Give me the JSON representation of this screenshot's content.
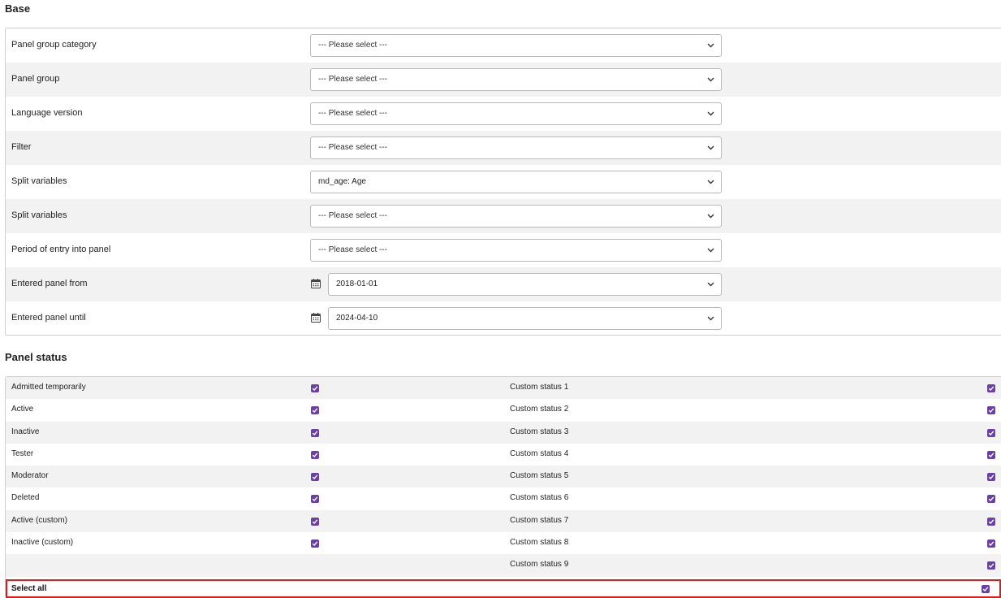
{
  "base": {
    "title": "Base",
    "rows": [
      {
        "label": "Panel group category",
        "value": "--- Please select ---"
      },
      {
        "label": "Panel group",
        "value": "--- Please select ---"
      },
      {
        "label": "Language version",
        "value": "--- Please select ---"
      },
      {
        "label": "Filter",
        "value": "--- Please select ---"
      },
      {
        "label": "Split variables",
        "value": "md_age: Age"
      },
      {
        "label": "Split variables",
        "value": "--- Please select ---"
      },
      {
        "label": "Period of entry into panel",
        "value": "--- Please select ---"
      },
      {
        "label": "Entered panel from",
        "value": "2018-01-01"
      },
      {
        "label": "Entered panel until",
        "value": "2024-04-10"
      }
    ]
  },
  "panel_status": {
    "title": "Panel status",
    "left_items": [
      "Admitted temporarily",
      "Active",
      "Inactive",
      "Tester",
      "Moderator",
      "Deleted",
      "Active (custom)",
      "Inactive (custom)"
    ],
    "right_items": [
      "Custom status 1",
      "Custom status 2",
      "Custom status 3",
      "Custom status 4",
      "Custom status 5",
      "Custom status 6",
      "Custom status 7",
      "Custom status 8",
      "Custom status 9"
    ],
    "select_all_label": "Select all"
  },
  "colors": {
    "checkbox": "#6b3fa8",
    "highlight_border": "#e01b1b",
    "row_stripe": "#f2f2f2"
  }
}
